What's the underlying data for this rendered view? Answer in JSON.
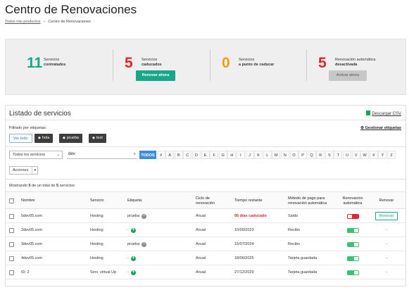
{
  "page": {
    "title": "Centro de Renovaciones",
    "breadcrumb": {
      "link": "Todos mis productos",
      "separator": "›",
      "current": "Centro de Renovaciones"
    }
  },
  "summary": {
    "stats": [
      {
        "number": "11",
        "line1": "Servicios",
        "line2": "contratados",
        "color": "#17a889"
      },
      {
        "number": "5",
        "line1": "Servicios",
        "line2": "caducados",
        "color": "#e0252f"
      },
      {
        "number": "0",
        "line1": "Servicios",
        "line2": "a punto de caducar",
        "color": "#f39c12"
      },
      {
        "number": "5",
        "line1": "Renovación automática",
        "line2": "desactivada",
        "color": "#e0252f"
      }
    ],
    "renew_now_label": "Renovar ahora",
    "activate_now_label": "Activar ahora"
  },
  "services": {
    "title": "Listado de servicios",
    "csv_label": "Descargar CSV",
    "filter_label": "Filtrado por etiquetas:",
    "manage_tags_label": "Gestionar etiquetas",
    "tags": [
      "Ver todo",
      "hola",
      "prueba",
      "test"
    ],
    "type_select": "Todos los servicios",
    "search_value": "dev",
    "letters": [
      "TODOS",
      "#",
      "A",
      "B",
      "C",
      "D",
      "E",
      "F",
      "G",
      "H",
      "I",
      "J",
      "K",
      "L",
      "M",
      "N",
      "O",
      "P",
      "Q",
      "R",
      "S",
      "T",
      "U",
      "V",
      "W",
      "X",
      "Y",
      "Z"
    ],
    "actions_label": "Acciones",
    "count": {
      "prefix": "Mostrando",
      "shown": "5",
      "middle": "de un total de",
      "total": "5",
      "suffix": "servicios"
    },
    "columns": {
      "name": "Nombre",
      "service": "Servicio",
      "tag": "Etiqueta",
      "cycle": "Ciclo de renovación",
      "time": "Tiempo restante",
      "payment": "Método de pago para renovación automática",
      "auto": "Renovación automática",
      "renew": "Renovar"
    },
    "rows": [
      {
        "name": "5dev05.com",
        "service": "Hosting",
        "tag": "prueba",
        "tag_action": "remove",
        "cycle": "Anual",
        "time": "95 días caducado",
        "expired": true,
        "payment": "Saldo",
        "auto": "off",
        "renew": "Renovar"
      },
      {
        "name": "2dev05.com",
        "service": "Hosting",
        "tag": "-",
        "tag_action": "add",
        "cycle": "Anual",
        "time": "10/09/2023",
        "expired": false,
        "payment": "Recibo",
        "auto": "on",
        "renew": "-"
      },
      {
        "name": "3dev05.com",
        "service": "Hosting",
        "tag": "prueba",
        "tag_action": "remove",
        "cycle": "Anual",
        "time": "15/07/2024",
        "expired": false,
        "payment": "Recibo",
        "auto": "on",
        "renew": "-"
      },
      {
        "name": "4dev05.com",
        "service": "Hosting",
        "tag": "-",
        "tag_action": "add",
        "cycle": "Anual",
        "time": "18/06/2025",
        "expired": false,
        "payment": "Tarjeta guardada",
        "auto": "on",
        "renew": "-"
      },
      {
        "name": "ID: 2",
        "service": "Serv. virtual Up",
        "tag": "-",
        "tag_action": "add",
        "cycle": "Anual",
        "time": "27/12/2029",
        "expired": false,
        "payment": "Tarjeta guardada",
        "auto": "on",
        "renew": "-"
      }
    ]
  }
}
